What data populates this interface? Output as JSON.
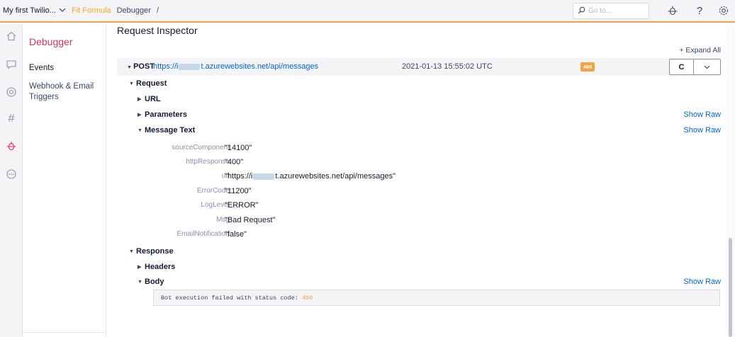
{
  "topbar": {
    "account": "My first Twilio...",
    "project": "Fit Formula",
    "page": "Debugger",
    "slash": "/",
    "goto_placeholder": "Go to..."
  },
  "icons": {
    "topbar": [
      "search-icon",
      "debugger-bug-icon",
      "help-icon",
      "settings-gear-icon"
    ],
    "rail": [
      "home-icon",
      "chat-icon",
      "support-icon",
      "hash-icon",
      "debugger-bug-icon",
      "more-icon"
    ]
  },
  "sidebar": {
    "title": "Debugger",
    "items": [
      {
        "label": "Events"
      },
      {
        "label": "Webhook & Email Triggers"
      }
    ]
  },
  "main": {
    "title": "Request Inspector",
    "expand_all": "+ Expand All",
    "request_row": {
      "method": "POST",
      "url_prefix": "https://i",
      "url_suffix": "t.azurewebsites.net/api/messages",
      "timestamp": "2021-01-13 15:55:02 UTC",
      "status": "400",
      "refresh_label": "C",
      "more_label": "∨"
    },
    "sections": {
      "request": "Request",
      "url": "URL",
      "parameters": "Parameters",
      "message_text": "Message Text",
      "response": "Response",
      "headers": "Headers",
      "body": "Body",
      "show_raw": "Show Raw"
    },
    "message_fields": [
      {
        "key": "sourceComponent",
        "value": "\"14100\""
      },
      {
        "key": "httpResponse",
        "value": "\"400\""
      },
      {
        "key": "url",
        "value_prefix": "\"https://i",
        "value_suffix": "t.azurewebsites.net/api/messages\""
      },
      {
        "key": "ErrorCode",
        "value": "\"11200\""
      },
      {
        "key": "LogLevel",
        "value": "\"ERROR\""
      },
      {
        "key": "Msg",
        "value": "\"Bad Request\""
      },
      {
        "key": "EmailNotification",
        "value": "\"false\""
      }
    ],
    "body_text": "Bot execution failed with status code: ",
    "body_code": "400"
  },
  "colors": {
    "accent_orange": "#f2a341",
    "brand_red": "#d6325a",
    "link_blue": "#0263e0"
  }
}
